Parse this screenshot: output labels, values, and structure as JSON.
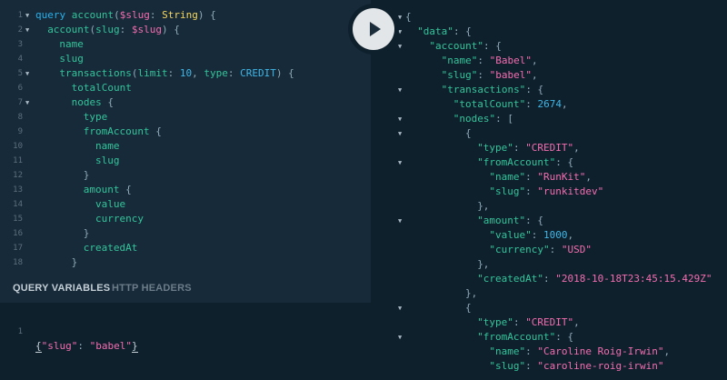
{
  "query_editor": {
    "lines": [
      {
        "n": "1",
        "fold": true,
        "indent": 0,
        "tokens": [
          [
            "kw",
            "query "
          ],
          [
            "fld",
            "account"
          ],
          [
            "punc",
            "("
          ],
          [
            "var",
            "$slug"
          ],
          [
            "punc",
            ": "
          ],
          [
            "type",
            "String"
          ],
          [
            "punc",
            ") {"
          ]
        ]
      },
      {
        "n": "2",
        "fold": true,
        "indent": 1,
        "tokens": [
          [
            "fld",
            "account"
          ],
          [
            "punc",
            "("
          ],
          [
            "fld",
            "slug"
          ],
          [
            "punc",
            ": "
          ],
          [
            "var",
            "$slug"
          ],
          [
            "punc",
            ") {"
          ]
        ]
      },
      {
        "n": "3",
        "fold": false,
        "indent": 2,
        "tokens": [
          [
            "fld",
            "name"
          ]
        ]
      },
      {
        "n": "4",
        "fold": false,
        "indent": 2,
        "tokens": [
          [
            "fld",
            "slug"
          ]
        ]
      },
      {
        "n": "5",
        "fold": true,
        "indent": 2,
        "tokens": [
          [
            "fld",
            "transactions"
          ],
          [
            "punc",
            "("
          ],
          [
            "fld",
            "limit"
          ],
          [
            "punc",
            ": "
          ],
          [
            "num",
            "10"
          ],
          [
            "punc",
            ", "
          ],
          [
            "fld",
            "type"
          ],
          [
            "punc",
            ": "
          ],
          [
            "enum",
            "CREDIT"
          ],
          [
            "punc",
            ") {"
          ]
        ]
      },
      {
        "n": "6",
        "fold": false,
        "indent": 3,
        "tokens": [
          [
            "fld",
            "totalCount"
          ]
        ]
      },
      {
        "n": "7",
        "fold": true,
        "indent": 3,
        "tokens": [
          [
            "fld",
            "nodes"
          ],
          [
            "punc",
            " {"
          ]
        ]
      },
      {
        "n": "8",
        "fold": false,
        "indent": 4,
        "tokens": [
          [
            "fld",
            "type"
          ]
        ]
      },
      {
        "n": "9",
        "fold": false,
        "indent": 4,
        "tokens": [
          [
            "fld",
            "fromAccount"
          ],
          [
            "punc",
            " {"
          ]
        ]
      },
      {
        "n": "10",
        "fold": false,
        "indent": 5,
        "tokens": [
          [
            "fld",
            "name"
          ]
        ]
      },
      {
        "n": "11",
        "fold": false,
        "indent": 5,
        "tokens": [
          [
            "fld",
            "slug"
          ]
        ]
      },
      {
        "n": "12",
        "fold": false,
        "indent": 4,
        "tokens": [
          [
            "punc",
            "}"
          ]
        ]
      },
      {
        "n": "13",
        "fold": false,
        "indent": 4,
        "tokens": [
          [
            "fld",
            "amount"
          ],
          [
            "punc",
            " {"
          ]
        ]
      },
      {
        "n": "14",
        "fold": false,
        "indent": 5,
        "tokens": [
          [
            "fld",
            "value"
          ]
        ]
      },
      {
        "n": "15",
        "fold": false,
        "indent": 5,
        "tokens": [
          [
            "fld",
            "currency"
          ]
        ]
      },
      {
        "n": "16",
        "fold": false,
        "indent": 4,
        "tokens": [
          [
            "punc",
            "}"
          ]
        ]
      },
      {
        "n": "17",
        "fold": false,
        "indent": 4,
        "tokens": [
          [
            "fld",
            "createdAt"
          ]
        ]
      },
      {
        "n": "18",
        "fold": false,
        "indent": 3,
        "tokens": [
          [
            "punc",
            "}"
          ]
        ]
      }
    ]
  },
  "variables_panel": {
    "tab_query_variables": "QUERY VARIABLES",
    "tab_http_headers": "HTTP HEADERS",
    "line_number": "1",
    "open_brace": "{",
    "key": "\"slug\"",
    "colon": ": ",
    "value": "\"babel\"",
    "close_brace": "}"
  },
  "run_button": {
    "icon": "play-icon"
  },
  "result": {
    "lines": [
      {
        "fold": true,
        "indent": 0,
        "tokens": [
          [
            "punc",
            "{"
          ]
        ]
      },
      {
        "fold": true,
        "indent": 1,
        "tokens": [
          [
            "key",
            "\"data\""
          ],
          [
            "punc",
            ": {"
          ]
        ]
      },
      {
        "fold": true,
        "indent": 2,
        "tokens": [
          [
            "key",
            "\"account\""
          ],
          [
            "punc",
            ": {"
          ]
        ]
      },
      {
        "fold": false,
        "indent": 3,
        "tokens": [
          [
            "key",
            "\"name\""
          ],
          [
            "punc",
            ": "
          ],
          [
            "rstr",
            "\"Babel\""
          ],
          [
            "punc",
            ","
          ]
        ]
      },
      {
        "fold": false,
        "indent": 3,
        "tokens": [
          [
            "key",
            "\"slug\""
          ],
          [
            "punc",
            ": "
          ],
          [
            "rstr",
            "\"babel\""
          ],
          [
            "punc",
            ","
          ]
        ]
      },
      {
        "fold": true,
        "indent": 3,
        "tokens": [
          [
            "key",
            "\"transactions\""
          ],
          [
            "punc",
            ": {"
          ]
        ]
      },
      {
        "fold": false,
        "indent": 4,
        "tokens": [
          [
            "key",
            "\"totalCount\""
          ],
          [
            "punc",
            ": "
          ],
          [
            "rnum",
            "2674"
          ],
          [
            "punc",
            ","
          ]
        ]
      },
      {
        "fold": true,
        "indent": 4,
        "tokens": [
          [
            "key",
            "\"nodes\""
          ],
          [
            "punc",
            ": ["
          ]
        ]
      },
      {
        "fold": true,
        "indent": 5,
        "tokens": [
          [
            "punc",
            "{"
          ]
        ]
      },
      {
        "fold": false,
        "indent": 6,
        "tokens": [
          [
            "key",
            "\"type\""
          ],
          [
            "punc",
            ": "
          ],
          [
            "rstr",
            "\"CREDIT\""
          ],
          [
            "punc",
            ","
          ]
        ]
      },
      {
        "fold": true,
        "indent": 6,
        "tokens": [
          [
            "key",
            "\"fromAccount\""
          ],
          [
            "punc",
            ": {"
          ]
        ]
      },
      {
        "fold": false,
        "indent": 7,
        "tokens": [
          [
            "key",
            "\"name\""
          ],
          [
            "punc",
            ": "
          ],
          [
            "rstr",
            "\"RunKit\""
          ],
          [
            "punc",
            ","
          ]
        ]
      },
      {
        "fold": false,
        "indent": 7,
        "tokens": [
          [
            "key",
            "\"slug\""
          ],
          [
            "punc",
            ": "
          ],
          [
            "rstr",
            "\"runkitdev\""
          ]
        ]
      },
      {
        "fold": false,
        "indent": 6,
        "tokens": [
          [
            "punc",
            "},"
          ]
        ]
      },
      {
        "fold": true,
        "indent": 6,
        "tokens": [
          [
            "key",
            "\"amount\""
          ],
          [
            "punc",
            ": {"
          ]
        ]
      },
      {
        "fold": false,
        "indent": 7,
        "tokens": [
          [
            "key",
            "\"value\""
          ],
          [
            "punc",
            ": "
          ],
          [
            "rnum",
            "1000"
          ],
          [
            "punc",
            ","
          ]
        ]
      },
      {
        "fold": false,
        "indent": 7,
        "tokens": [
          [
            "key",
            "\"currency\""
          ],
          [
            "punc",
            ": "
          ],
          [
            "rstr",
            "\"USD\""
          ]
        ]
      },
      {
        "fold": false,
        "indent": 6,
        "tokens": [
          [
            "punc",
            "},"
          ]
        ]
      },
      {
        "fold": false,
        "indent": 6,
        "tokens": [
          [
            "key",
            "\"createdAt\""
          ],
          [
            "punc",
            ": "
          ],
          [
            "rstr",
            "\"2018-10-18T23:45:15.429Z\""
          ]
        ]
      },
      {
        "fold": false,
        "indent": 5,
        "tokens": [
          [
            "punc",
            "},"
          ]
        ]
      },
      {
        "fold": true,
        "indent": 5,
        "tokens": [
          [
            "punc",
            "{"
          ]
        ]
      },
      {
        "fold": false,
        "indent": 6,
        "tokens": [
          [
            "key",
            "\"type\""
          ],
          [
            "punc",
            ": "
          ],
          [
            "rstr",
            "\"CREDIT\""
          ],
          [
            "punc",
            ","
          ]
        ]
      },
      {
        "fold": true,
        "indent": 6,
        "tokens": [
          [
            "key",
            "\"fromAccount\""
          ],
          [
            "punc",
            ": {"
          ]
        ]
      },
      {
        "fold": false,
        "indent": 7,
        "tokens": [
          [
            "key",
            "\"name\""
          ],
          [
            "punc",
            ": "
          ],
          [
            "rstr",
            "\"Caroline Roig-Irwin\""
          ],
          [
            "punc",
            ","
          ]
        ]
      },
      {
        "fold": false,
        "indent": 7,
        "tokens": [
          [
            "key",
            "\"slug\""
          ],
          [
            "punc",
            ": "
          ],
          [
            "rstr",
            "\"caroline-roig-irwin\""
          ]
        ]
      }
    ]
  }
}
